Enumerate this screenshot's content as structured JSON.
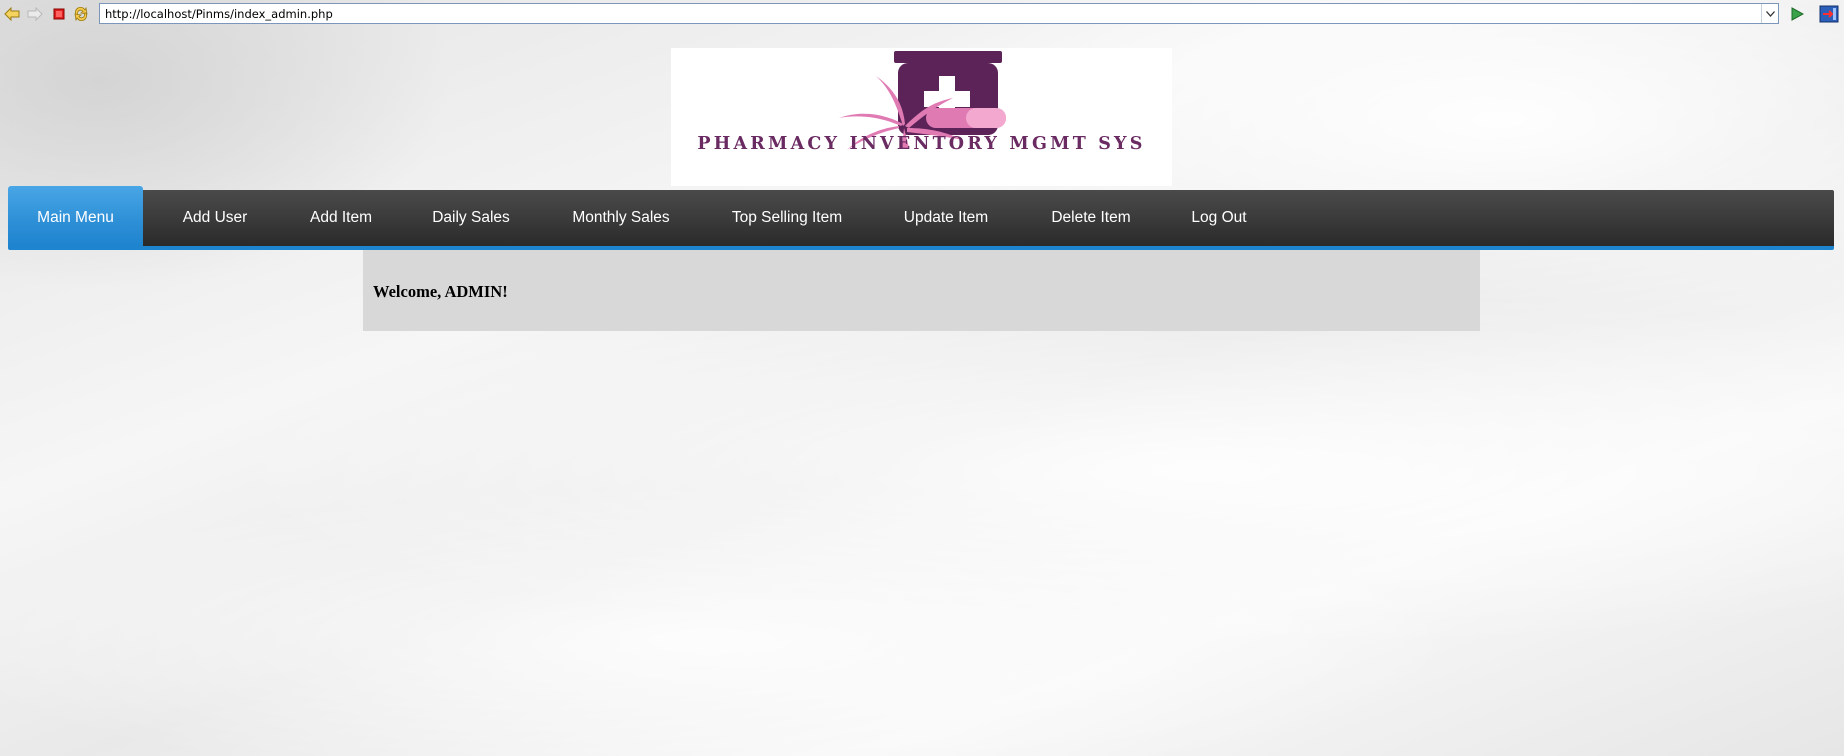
{
  "browser": {
    "url": "http://localhost/Pinms/index_admin.php"
  },
  "logo": {
    "text": "PHARMACY INVENTORY MGMT SYS",
    "colors": {
      "purple": "#5c2358",
      "pink": "#e07ab3"
    }
  },
  "nav": {
    "items": [
      {
        "label": "Main Menu",
        "active": true
      },
      {
        "label": "Add User"
      },
      {
        "label": "Add Item"
      },
      {
        "label": "Daily Sales"
      },
      {
        "label": "Monthly Sales"
      },
      {
        "label": "Top Selling Item"
      },
      {
        "label": "Update Item"
      },
      {
        "label": "Delete Item"
      },
      {
        "label": "Log Out"
      }
    ],
    "accent": "#1f84cf"
  },
  "content": {
    "welcome": "Welcome, ADMIN!"
  }
}
